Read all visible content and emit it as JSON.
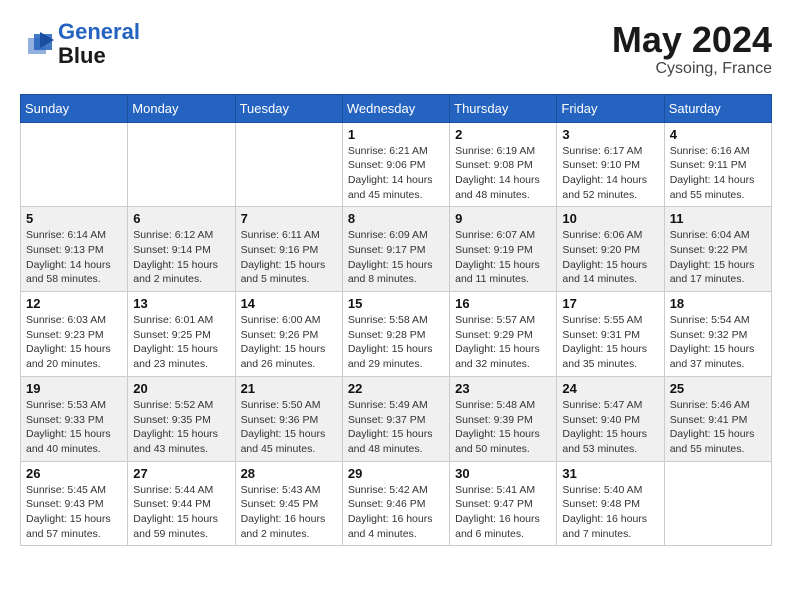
{
  "header": {
    "logo_line1": "General",
    "logo_line2": "Blue",
    "month": "May 2024",
    "location": "Cysoing, France"
  },
  "weekdays": [
    "Sunday",
    "Monday",
    "Tuesday",
    "Wednesday",
    "Thursday",
    "Friday",
    "Saturday"
  ],
  "weeks": [
    [
      {
        "day": "",
        "info": ""
      },
      {
        "day": "",
        "info": ""
      },
      {
        "day": "",
        "info": ""
      },
      {
        "day": "1",
        "info": "Sunrise: 6:21 AM\nSunset: 9:06 PM\nDaylight: 14 hours\nand 45 minutes."
      },
      {
        "day": "2",
        "info": "Sunrise: 6:19 AM\nSunset: 9:08 PM\nDaylight: 14 hours\nand 48 minutes."
      },
      {
        "day": "3",
        "info": "Sunrise: 6:17 AM\nSunset: 9:10 PM\nDaylight: 14 hours\nand 52 minutes."
      },
      {
        "day": "4",
        "info": "Sunrise: 6:16 AM\nSunset: 9:11 PM\nDaylight: 14 hours\nand 55 minutes."
      }
    ],
    [
      {
        "day": "5",
        "info": "Sunrise: 6:14 AM\nSunset: 9:13 PM\nDaylight: 14 hours\nand 58 minutes."
      },
      {
        "day": "6",
        "info": "Sunrise: 6:12 AM\nSunset: 9:14 PM\nDaylight: 15 hours\nand 2 minutes."
      },
      {
        "day": "7",
        "info": "Sunrise: 6:11 AM\nSunset: 9:16 PM\nDaylight: 15 hours\nand 5 minutes."
      },
      {
        "day": "8",
        "info": "Sunrise: 6:09 AM\nSunset: 9:17 PM\nDaylight: 15 hours\nand 8 minutes."
      },
      {
        "day": "9",
        "info": "Sunrise: 6:07 AM\nSunset: 9:19 PM\nDaylight: 15 hours\nand 11 minutes."
      },
      {
        "day": "10",
        "info": "Sunrise: 6:06 AM\nSunset: 9:20 PM\nDaylight: 15 hours\nand 14 minutes."
      },
      {
        "day": "11",
        "info": "Sunrise: 6:04 AM\nSunset: 9:22 PM\nDaylight: 15 hours\nand 17 minutes."
      }
    ],
    [
      {
        "day": "12",
        "info": "Sunrise: 6:03 AM\nSunset: 9:23 PM\nDaylight: 15 hours\nand 20 minutes."
      },
      {
        "day": "13",
        "info": "Sunrise: 6:01 AM\nSunset: 9:25 PM\nDaylight: 15 hours\nand 23 minutes."
      },
      {
        "day": "14",
        "info": "Sunrise: 6:00 AM\nSunset: 9:26 PM\nDaylight: 15 hours\nand 26 minutes."
      },
      {
        "day": "15",
        "info": "Sunrise: 5:58 AM\nSunset: 9:28 PM\nDaylight: 15 hours\nand 29 minutes."
      },
      {
        "day": "16",
        "info": "Sunrise: 5:57 AM\nSunset: 9:29 PM\nDaylight: 15 hours\nand 32 minutes."
      },
      {
        "day": "17",
        "info": "Sunrise: 5:55 AM\nSunset: 9:31 PM\nDaylight: 15 hours\nand 35 minutes."
      },
      {
        "day": "18",
        "info": "Sunrise: 5:54 AM\nSunset: 9:32 PM\nDaylight: 15 hours\nand 37 minutes."
      }
    ],
    [
      {
        "day": "19",
        "info": "Sunrise: 5:53 AM\nSunset: 9:33 PM\nDaylight: 15 hours\nand 40 minutes."
      },
      {
        "day": "20",
        "info": "Sunrise: 5:52 AM\nSunset: 9:35 PM\nDaylight: 15 hours\nand 43 minutes."
      },
      {
        "day": "21",
        "info": "Sunrise: 5:50 AM\nSunset: 9:36 PM\nDaylight: 15 hours\nand 45 minutes."
      },
      {
        "day": "22",
        "info": "Sunrise: 5:49 AM\nSunset: 9:37 PM\nDaylight: 15 hours\nand 48 minutes."
      },
      {
        "day": "23",
        "info": "Sunrise: 5:48 AM\nSunset: 9:39 PM\nDaylight: 15 hours\nand 50 minutes."
      },
      {
        "day": "24",
        "info": "Sunrise: 5:47 AM\nSunset: 9:40 PM\nDaylight: 15 hours\nand 53 minutes."
      },
      {
        "day": "25",
        "info": "Sunrise: 5:46 AM\nSunset: 9:41 PM\nDaylight: 15 hours\nand 55 minutes."
      }
    ],
    [
      {
        "day": "26",
        "info": "Sunrise: 5:45 AM\nSunset: 9:43 PM\nDaylight: 15 hours\nand 57 minutes."
      },
      {
        "day": "27",
        "info": "Sunrise: 5:44 AM\nSunset: 9:44 PM\nDaylight: 15 hours\nand 59 minutes."
      },
      {
        "day": "28",
        "info": "Sunrise: 5:43 AM\nSunset: 9:45 PM\nDaylight: 16 hours\nand 2 minutes."
      },
      {
        "day": "29",
        "info": "Sunrise: 5:42 AM\nSunset: 9:46 PM\nDaylight: 16 hours\nand 4 minutes."
      },
      {
        "day": "30",
        "info": "Sunrise: 5:41 AM\nSunset: 9:47 PM\nDaylight: 16 hours\nand 6 minutes."
      },
      {
        "day": "31",
        "info": "Sunrise: 5:40 AM\nSunset: 9:48 PM\nDaylight: 16 hours\nand 7 minutes."
      },
      {
        "day": "",
        "info": ""
      }
    ]
  ]
}
